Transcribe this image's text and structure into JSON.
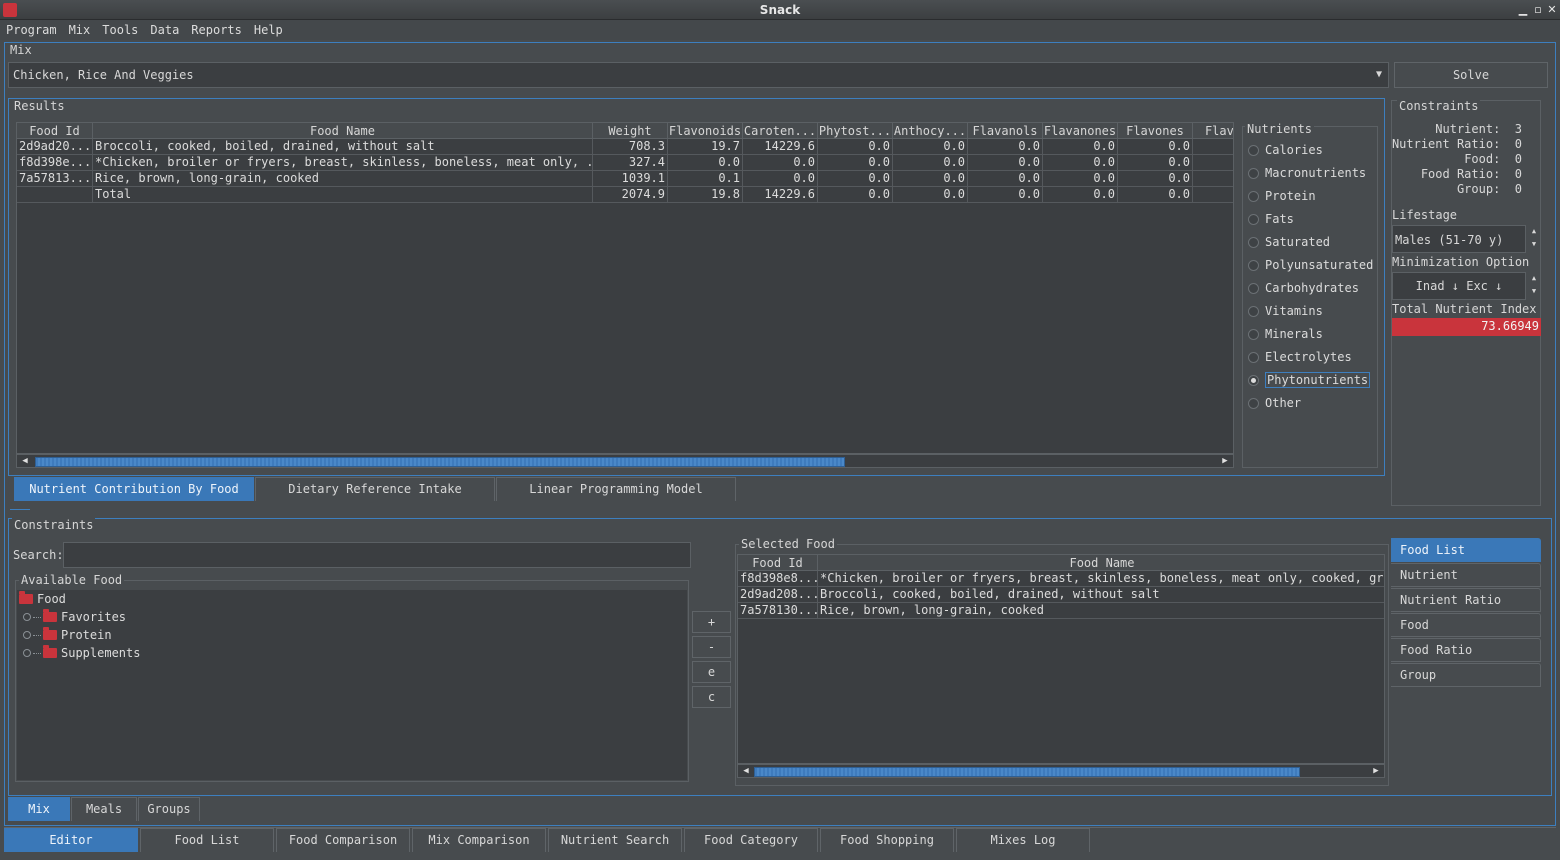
{
  "window": {
    "title": "Snack"
  },
  "menu": [
    "Program",
    "Mix",
    "Tools",
    "Data",
    "Reports",
    "Help"
  ],
  "mix": {
    "label": "Mix",
    "selected": "Chicken, Rice And Veggies",
    "solve_label": "Solve"
  },
  "results": {
    "label": "Results",
    "columns": [
      "Food Id",
      "Food Name",
      "Weight",
      "Flavonoids",
      "Caroten...",
      "Phytost...",
      "Anthocy...",
      "Flavanols",
      "Flavanones",
      "Flavones",
      "Flavo"
    ],
    "rows": [
      [
        "2d9ad20...",
        "Broccoli, cooked, boiled, drained, without salt",
        "708.3",
        "19.7",
        "14229.6",
        "0.0",
        "0.0",
        "0.0",
        "0.0",
        "0.0",
        ""
      ],
      [
        "f8d398e...",
        "*Chicken, broiler or fryers, breast, skinless, boneless, meat only, ...",
        "327.4",
        "0.0",
        "0.0",
        "0.0",
        "0.0",
        "0.0",
        "0.0",
        "0.0",
        ""
      ],
      [
        "7a57813...",
        "Rice, brown, long-grain, cooked",
        "1039.1",
        "0.1",
        "0.0",
        "0.0",
        "0.0",
        "0.0",
        "0.0",
        "0.0",
        ""
      ],
      [
        "",
        "Total",
        "2074.9",
        "19.8",
        "14229.6",
        "0.0",
        "0.0",
        "0.0",
        "0.0",
        "0.0",
        ""
      ]
    ]
  },
  "nutrients": {
    "label": "Nutrients",
    "options": [
      "Calories",
      "Macronutrients",
      "Protein",
      "Fats",
      "Saturated",
      "Polyunsaturated",
      "Carbohydrates",
      "Vitamins",
      "Minerals",
      "Electrolytes",
      "Phytonutrients",
      "Other"
    ],
    "selected": "Phytonutrients"
  },
  "result_tabs": [
    "Nutrient Contribution By Food",
    "Dietary Reference Intake",
    "Linear Programming Model"
  ],
  "constraints_summary": {
    "label": "Constraints",
    "items": [
      {
        "label": "Nutrient:",
        "value": "3"
      },
      {
        "label": "Nutrient Ratio:",
        "value": "0"
      },
      {
        "label": "Food:",
        "value": "0"
      },
      {
        "label": "Food Ratio:",
        "value": "0"
      },
      {
        "label": "Group:",
        "value": "0"
      }
    ]
  },
  "lifestage": {
    "label": "Lifestage",
    "value": "Males (51-70 y)"
  },
  "minimization": {
    "label": "Minimization Option",
    "value": "Inad ↓ Exc ↓"
  },
  "total_nutrient_index": {
    "label": "Total Nutrient Index",
    "value": "73.66949",
    "color": "#c9343c"
  },
  "constraints": {
    "label": "Constraints",
    "search_label": "Search:",
    "search_value": "",
    "available_label": "Available Food",
    "tree": {
      "root": "Food",
      "children": [
        "Favorites",
        "Protein",
        "Supplements"
      ]
    },
    "buttons": [
      "+",
      "-",
      "e",
      "c"
    ],
    "selected_label": "Selected Food",
    "selected_columns": [
      "Food Id",
      "Food Name"
    ],
    "selected_rows": [
      [
        "f8d398e8...",
        "*Chicken, broiler or fryers, breast, skinless, boneless, meat only, cooked, grill"
      ],
      [
        "2d9ad208...",
        "Broccoli, cooked, boiled, drained, without salt"
      ],
      [
        "7a578130...",
        "Rice, brown, long-grain, cooked"
      ]
    ],
    "side_tabs": [
      "Food List",
      "Nutrient",
      "Nutrient Ratio",
      "Food",
      "Food Ratio",
      "Group"
    ],
    "side_active": "Food List"
  },
  "mix_tabs": [
    "Mix",
    "Meals",
    "Groups"
  ],
  "bottom_tabs": [
    "Editor",
    "Food List",
    "Food Comparison",
    "Mix Comparison",
    "Nutrient Search",
    "Food Category",
    "Food Shopping",
    "Mixes Log"
  ]
}
